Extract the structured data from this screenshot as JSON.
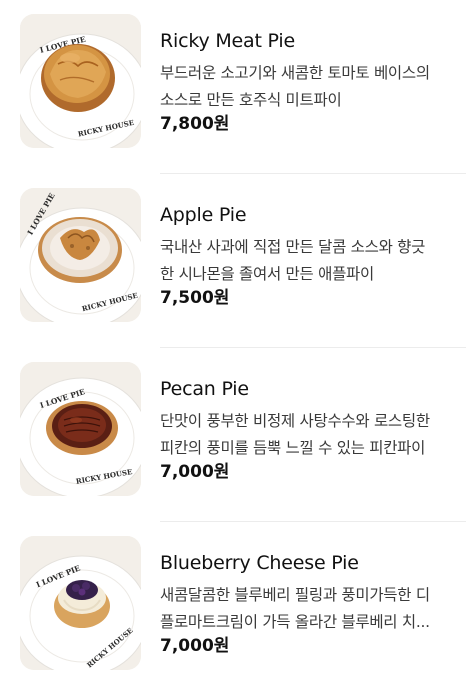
{
  "menu": {
    "items": [
      {
        "name": "Ricky Meat Pie",
        "desc_line1": "부드러운 소고기와 새콤한 토마토 베이스의",
        "desc_line2": "소스로 만든 호주식 미트파이",
        "price": "7,800원",
        "plate_text_top": "I LOVE PIE",
        "plate_text_bottom": "RICKY HOUSE"
      },
      {
        "name": "Apple Pie",
        "desc_line1": "국내산 사과에 직접 만든 달콤 소스와 향긋",
        "desc_line2": "한 시나몬을 졸여서 만든 애플파이",
        "price": "7,500원",
        "plate_text_top": "I LOVE PIE",
        "plate_text_bottom": "RICKY HOUSE"
      },
      {
        "name": "Pecan Pie",
        "desc_line1": "단맛이 풍부한 비정제 사탕수수와 로스팅한",
        "desc_line2": "피칸의 풍미를 듬뿍 느낄 수 있는 피칸파이",
        "price": "7,000원",
        "plate_text_top": "I LOVE PIE",
        "plate_text_bottom": "RICKY HOUSE"
      },
      {
        "name": "Blueberry Cheese Pie",
        "desc_line1": "새콤달콤한 블루베리 필링과 풍미가득한 디",
        "desc_line2": "플로마트크림이 가득 올라간 블루베리 치...",
        "price": "7,000원",
        "plate_text_top": "I LOVE PIE",
        "plate_text_bottom": "RICKY HOUSE"
      }
    ]
  }
}
